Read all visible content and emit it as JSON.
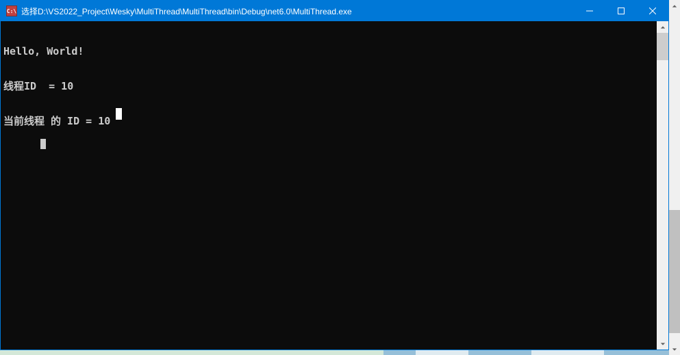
{
  "window": {
    "title": "选择D:\\VS2022_Project\\Wesky\\MultiThread\\MultiThread\\bin\\Debug\\net6.0\\MultiThread.exe",
    "icon_label": "C:\\"
  },
  "console": {
    "lines": [
      "Hello, World!",
      "线程ID  = 10",
      "当前线程 的 ID = 10"
    ]
  },
  "controls": {
    "minimize": "minimize",
    "maximize": "maximize",
    "close": "close"
  }
}
